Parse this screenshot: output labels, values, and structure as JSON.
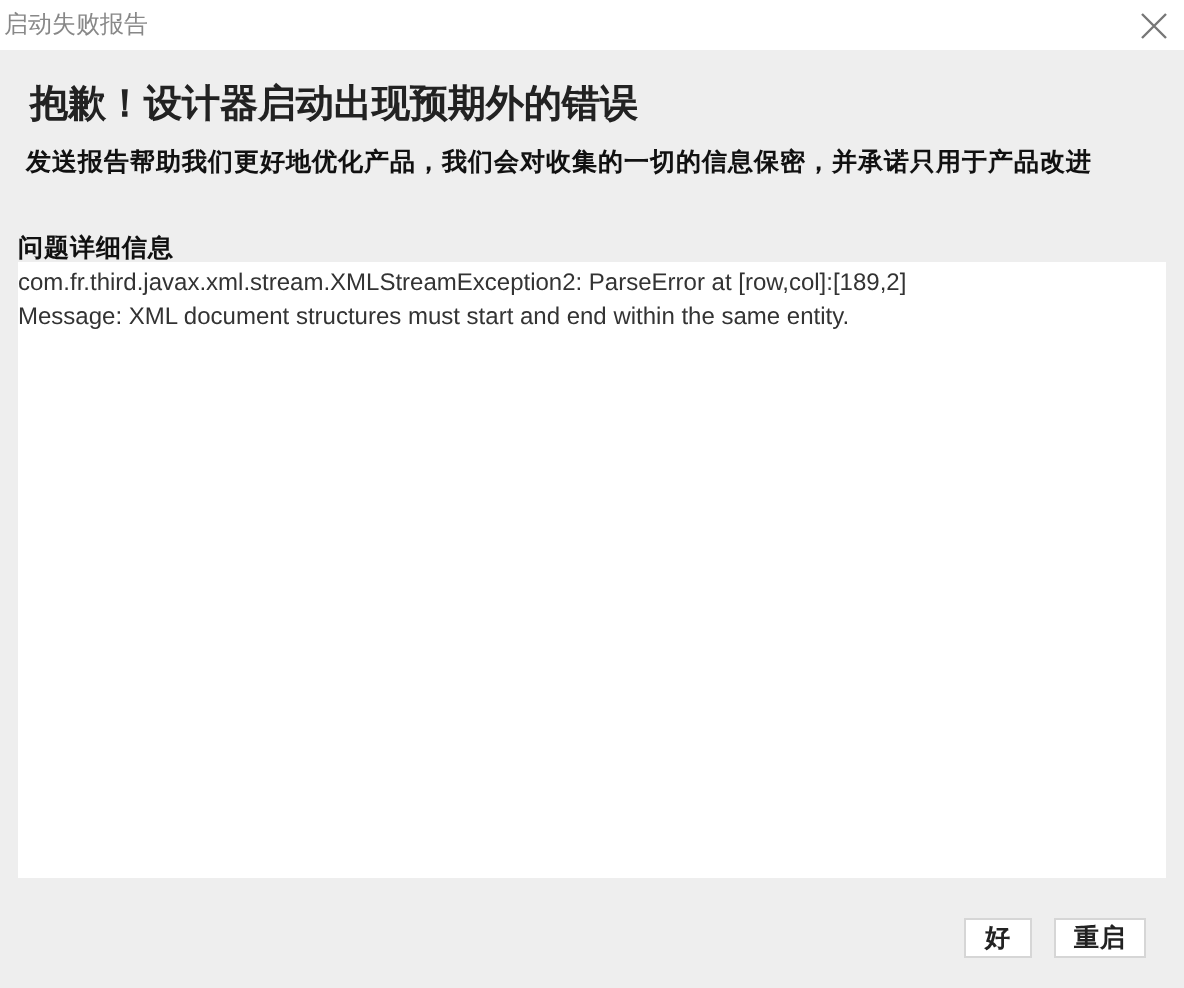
{
  "window": {
    "title": "启动失败报告"
  },
  "heading": "抱歉！设计器启动出现预期外的错误",
  "subtitle": "发送报告帮助我们更好地优化产品，我们会对收集的一切的信息保密，并承诺只用于产品改进",
  "details": {
    "label": "问题详细信息",
    "lines": [
      "com.fr.third.javax.xml.stream.XMLStreamException2: ParseError at [row,col]:[189,2]",
      "Message: XML document structures must start and end within the same entity."
    ]
  },
  "buttons": [
    "好",
    "重启"
  ]
}
